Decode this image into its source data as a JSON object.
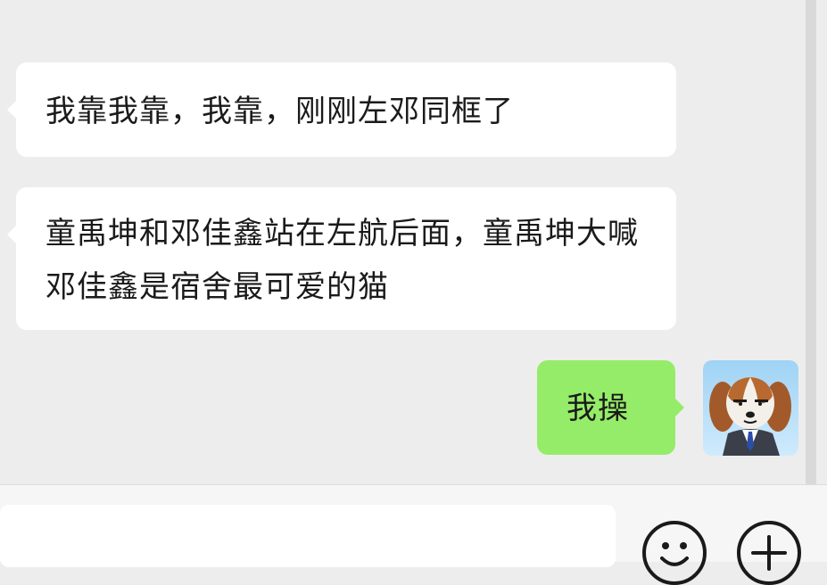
{
  "messages": [
    {
      "direction": "incoming",
      "text": "我靠我靠，我靠，刚刚左邓同框了"
    },
    {
      "direction": "incoming",
      "text": "童禹坤和邓佳鑫站在左航后面，童禹坤大喊邓佳鑫是宿舍最可爱的猫"
    },
    {
      "direction": "outgoing",
      "text": "我操"
    }
  ],
  "input": {
    "value": "",
    "placeholder": ""
  },
  "toolbar": {
    "emoji_icon": "smiley-face-icon",
    "plus_icon": "plus-circle-icon"
  },
  "colors": {
    "chat_background": "#ededed",
    "incoming_bubble": "#ffffff",
    "outgoing_bubble": "#95ec69",
    "input_bar": "#f6f6f6"
  }
}
